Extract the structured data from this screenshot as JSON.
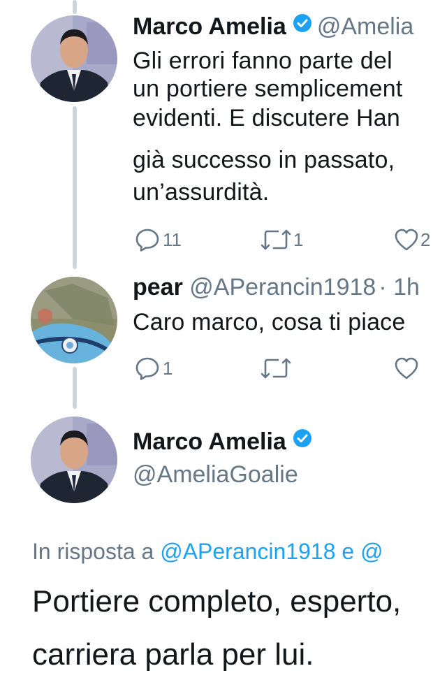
{
  "tweet1": {
    "name": "Marco Amelia",
    "handle": "@Amelia",
    "lines": [
      "Gli errori fanno parte del",
      "un portiere semplicement",
      "evidenti. E discutere Han",
      "già successo in passato,",
      "un’assurdità."
    ],
    "replies": "11",
    "retweets": "1",
    "likes": "2"
  },
  "tweet2": {
    "name": "pear",
    "handle": "@APerancin1918",
    "time": "· 1h",
    "text": "Caro marco, cosa ti piace",
    "replies": "1"
  },
  "main": {
    "name": "Marco Amelia",
    "handle": "@AmeliaGoalie",
    "reply_prefix": "In risposta a",
    "reply_user": "@APerancin1918",
    "reply_and": "e",
    "reply_more": "@",
    "lines": [
      "Portiere completo, esperto,",
      "carriera parla per lui."
    ]
  },
  "colors": {
    "accent": "#1da1f2",
    "secondary_text": "#657786",
    "thread_line": "#ccd6dd"
  }
}
